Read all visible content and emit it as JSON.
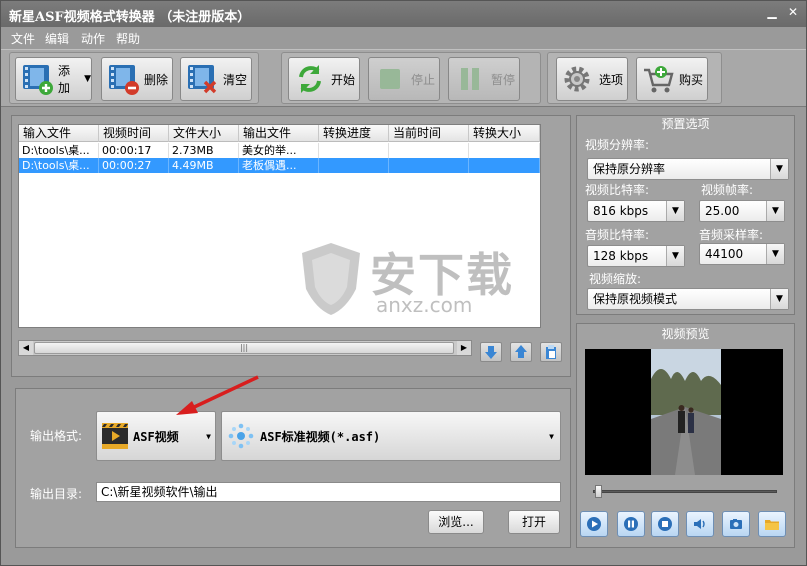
{
  "window": {
    "title": "新星ASF视频格式转换器 （未注册版本）"
  },
  "menu": [
    "文件",
    "编辑",
    "动作",
    "帮助"
  ],
  "toolbar": {
    "add": "添加",
    "delete": "删除",
    "clear": "清空",
    "start": "开始",
    "stop": "停止",
    "pause": "暂停",
    "options": "选项",
    "buy": "购买"
  },
  "table": {
    "headers": [
      "输入文件",
      "视频时间",
      "文件大小",
      "输出文件",
      "转换进度",
      "当前时间",
      "转换大小"
    ],
    "rows": [
      {
        "input": "D:\\tools\\桌...",
        "duration": "00:00:17",
        "size": "2.73MB",
        "output": "美女的举...",
        "progress": "",
        "current": "",
        "convsize": "",
        "selected": false
      },
      {
        "input": "D:\\tools\\桌...",
        "duration": "00:00:27",
        "size": "4.49MB",
        "output": "老板偶遇...",
        "progress": "",
        "current": "",
        "convsize": "",
        "selected": true
      }
    ]
  },
  "watermark": {
    "brand": "安下载",
    "domain": "anxz.com"
  },
  "presets": {
    "title": "预置选项",
    "resolution_label": "视频分辨率:",
    "resolution_value": "保持原分辨率",
    "vbitrate_label": "视频比特率:",
    "vbitrate_value": "816 kbps",
    "framerate_label": "视频帧率:",
    "framerate_value": "25.00",
    "abitrate_label": "音频比特率:",
    "abitrate_value": "128 kbps",
    "samplerate_label": "音频采样率:",
    "samplerate_value": "44100",
    "scale_label": "视频缩放:",
    "scale_value": "保持原视频模式"
  },
  "preview": {
    "title": "视频预览",
    "seek_position": 0.02
  },
  "output": {
    "format_label": "输出格式:",
    "format_value": "ASF视频",
    "profile_value": "ASF标准视频(*.asf)",
    "dir_label": "输出目录:",
    "dir_value": "C:\\新星视频软件\\输出",
    "browse": "浏览...",
    "open": "打开"
  }
}
